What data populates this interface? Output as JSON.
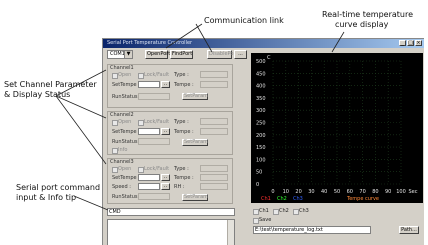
{
  "callouts": {
    "communication_link": "Communication link",
    "realtime_chart": [
      "Real-time temperature",
      "curve display"
    ],
    "set_channel": [
      "Set Channel Parameter",
      "& Display Status"
    ],
    "serial_port": [
      "Serial port command",
      "input & Info tip"
    ]
  },
  "window": {
    "title": "Serial Port Temperature Controller",
    "controls": [
      "_",
      "□",
      "×"
    ]
  },
  "toolbar": {
    "port": "COM1",
    "open_port": "OpenPort",
    "find_port": "FindPort",
    "disable_label": "DisablePort",
    "extra_label": "..."
  },
  "channels": [
    {
      "title": "Channel1",
      "opt1": "Open",
      "opt2": "Lock/Fault",
      "type": "Type :",
      "set_tempe": "SetTempe :",
      "tempe": "Tempe :",
      "run_status": "RunStatus :",
      "button": "SetParam"
    },
    {
      "title": "Channel2",
      "opt1": "Open",
      "opt2": "Lock/Fault",
      "type": "Type :",
      "set_tempe": "SetTempe :",
      "tempe": "Tempe :",
      "run_status": "RunStatus :",
      "button": "SetParam",
      "extra": "Info"
    },
    {
      "title": "Channel3",
      "opt1": "Open",
      "opt2": "Lock/Fault",
      "type": "Type :",
      "set_tempe": "SetTempe :",
      "tempe": "Tempe :",
      "speed": "Speed :",
      "rh": "RH :",
      "run_status": "RunStatus :",
      "button": "SetParam"
    }
  ],
  "command": {
    "value": "CMD"
  },
  "chart": {
    "unit": "C",
    "ylabels": [
      "500",
      "450",
      "400",
      "350",
      "300",
      "250",
      "200",
      "150",
      "100",
      "50",
      "0"
    ],
    "xlabels": [
      "0",
      "10",
      "20",
      "30",
      "40",
      "50",
      "60",
      "70",
      "80",
      "90",
      "100",
      "Sec"
    ],
    "legend": [
      {
        "name": "Ch1",
        "color": "#ff3030"
      },
      {
        "name": "Ch2",
        "color": "#30ff30"
      },
      {
        "name": "Ch3",
        "color": "#3060ff"
      },
      {
        "name": "Tempe curve",
        "color": "#ff8a3a"
      }
    ]
  },
  "under_chart": {
    "checks": [
      "Ch1",
      "Ch2",
      "Ch3"
    ],
    "save": "Save",
    "path": "E:\\test\\temperature_log.txt",
    "browse": "Path..."
  },
  "chart_data": {
    "type": "line",
    "ylabel": "C",
    "xlabel": "Sec",
    "x_ticks": [
      0,
      10,
      20,
      30,
      40,
      50,
      60,
      70,
      80,
      90,
      100
    ],
    "ylim": [
      0,
      500
    ],
    "xlim": [
      0,
      100
    ],
    "grid": true,
    "series": [
      {
        "name": "Ch1",
        "values": []
      },
      {
        "name": "Ch2",
        "values": []
      },
      {
        "name": "Ch3",
        "values": []
      }
    ]
  }
}
